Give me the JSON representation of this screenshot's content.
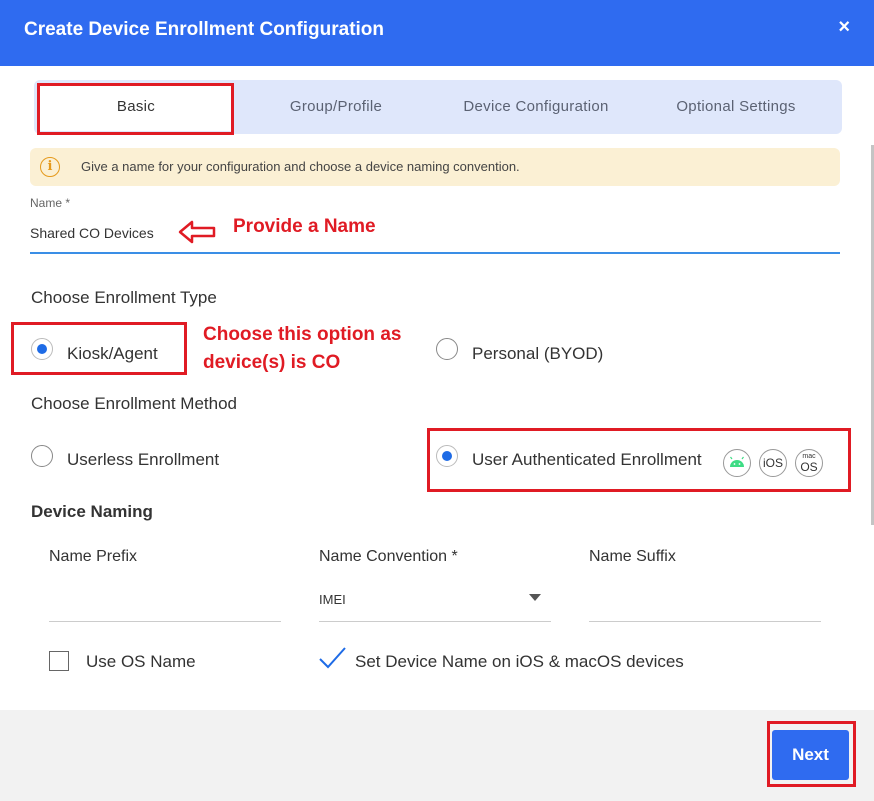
{
  "dialog": {
    "title": "Create Device Enrollment Configuration",
    "close_icon": "×"
  },
  "tabs": [
    {
      "label": "Basic",
      "active": true
    },
    {
      "label": "Group/Profile",
      "active": false
    },
    {
      "label": "Device Configuration",
      "active": false
    },
    {
      "label": "Optional Settings",
      "active": false
    }
  ],
  "info": {
    "icon": "i",
    "text": "Give a name for your configuration and choose a device naming convention."
  },
  "name_field": {
    "label": "Name *",
    "value": "Shared CO Devices"
  },
  "annotations": {
    "provide_name": "Provide a Name",
    "choose_option_line1": "Choose this option as",
    "choose_option_line2": "device(s) is CO",
    "color": "#e01b24"
  },
  "enrollment_type": {
    "title": "Choose Enrollment Type",
    "options": [
      {
        "label": "Kiosk/Agent",
        "selected": true
      },
      {
        "label": "Personal (BYOD)",
        "selected": false
      }
    ]
  },
  "enrollment_method": {
    "title": "Choose Enrollment Method",
    "options": [
      {
        "label": "Userless Enrollment",
        "selected": false
      },
      {
        "label": "User Authenticated Enrollment",
        "selected": true
      }
    ],
    "platform_icons": [
      {
        "name": "android-icon"
      },
      {
        "name": "ios-icon",
        "text": "iOS"
      },
      {
        "name": "macos-icon",
        "text_top": "mac",
        "text_bottom": "OS"
      }
    ]
  },
  "device_naming": {
    "title": "Device Naming",
    "prefix_label": "Name Prefix",
    "prefix_value": "",
    "convention_label": "Name Convention *",
    "convention_value": "IMEI",
    "suffix_label": "Name Suffix",
    "suffix_value": "",
    "use_os_name_label": "Use OS Name",
    "use_os_name_checked": false,
    "set_device_name_label": "Set Device Name on iOS & macOS devices",
    "set_device_name_checked": true
  },
  "footer": {
    "next_label": "Next"
  },
  "colors": {
    "primary": "#2f6bf0",
    "info_bg": "#fbf0d4",
    "info_icon": "#e59a1c",
    "annotation": "#e01b24",
    "android": "#3ddc84"
  }
}
